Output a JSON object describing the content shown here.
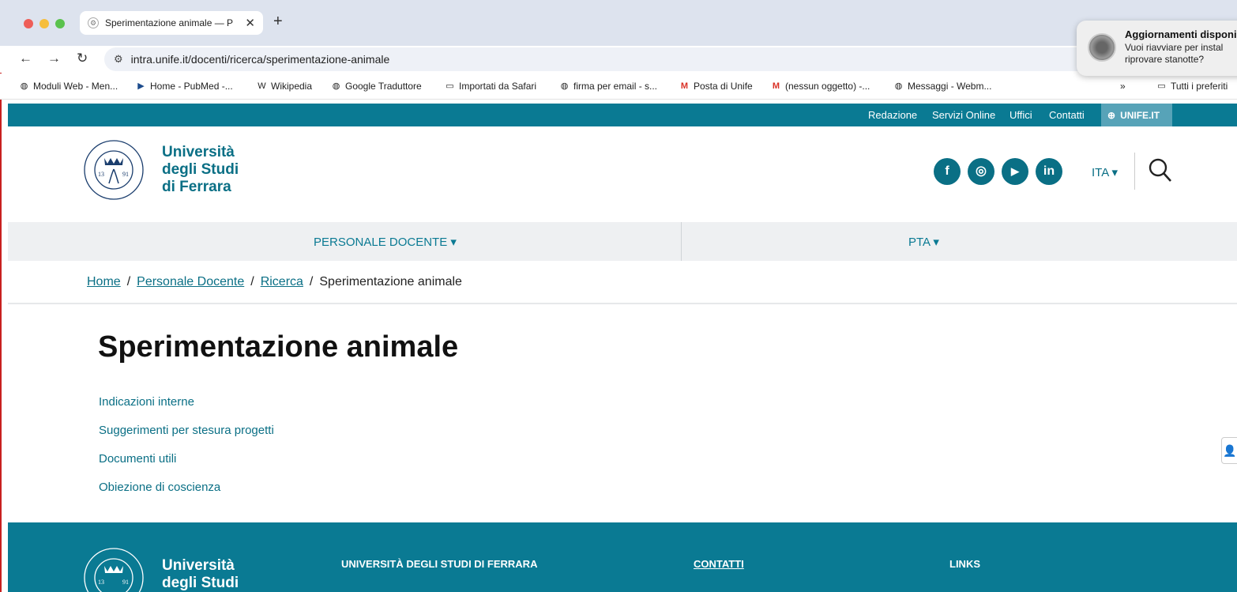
{
  "browser": {
    "tab_title": "Sperimentazione animale — P",
    "tab_close": "✕",
    "new_tab": "+",
    "url": "intra.unife.it/docenti/ricerca/sperimentazione-animale",
    "back_icon": "arrow-left-icon",
    "forward_icon": "arrow-right-icon",
    "reload_icon": "reload-icon",
    "bookmarks": [
      {
        "label": "Moduli Web - Men...",
        "icon": "globe-icon"
      },
      {
        "label": "Home - PubMed -...",
        "icon": "pubmed-icon"
      },
      {
        "label": "Wikipedia",
        "icon": "wikipedia-icon"
      },
      {
        "label": "Google Traduttore",
        "icon": "globe-icon"
      },
      {
        "label": "Importati da Safari",
        "icon": "folder-icon"
      },
      {
        "label": "firma per email - s...",
        "icon": "globe-icon"
      },
      {
        "label": "Posta di Unife",
        "icon": "gmail-icon"
      },
      {
        "label": "(nessun oggetto) -...",
        "icon": "gmail-icon"
      },
      {
        "label": "Messaggi - Webm...",
        "icon": "globe-icon"
      }
    ],
    "bookmarks_more": "»",
    "all_bookmarks": "Tutti i preferiti"
  },
  "notification": {
    "title": "Aggiornamenti disponi",
    "body": "Vuoi riavviare per instal riprovare stanotte?"
  },
  "topbar": {
    "links": [
      "Redazione",
      "Servizi Online",
      "Uffici",
      "Contatti"
    ],
    "unife": "UNIFE.IT"
  },
  "header": {
    "brand_line1": "Università",
    "brand_line2": "degli Studi",
    "brand_line3": "di Ferrara",
    "seal_text_top": "FERRARIAE UNIVERSITAS",
    "seal_text_bottom": "EX LABORE FRUCTUS",
    "seal_year_left": "13",
    "seal_year_right": "91",
    "social": [
      {
        "name": "facebook",
        "glyph": "f"
      },
      {
        "name": "instagram",
        "glyph": "◎"
      },
      {
        "name": "youtube",
        "glyph": "▶"
      },
      {
        "name": "linkedin",
        "glyph": "in"
      }
    ],
    "language": "ITA ▾"
  },
  "menu": {
    "items": [
      "PERSONALE DOCENTE ▾",
      "PTA ▾"
    ]
  },
  "breadcrumb": {
    "home": "Home",
    "level1": "Personale Docente",
    "level2": "Ricerca",
    "current": "Sperimentazione animale",
    "separator": "/"
  },
  "main": {
    "title": "Sperimentazione animale",
    "links": [
      "Indicazioni interne",
      "Suggerimenti per stesura progetti",
      "Documenti utili",
      "Obiezione di coscienza"
    ]
  },
  "footer": {
    "brand_line1": "Università",
    "brand_line2": "degli Studi",
    "col1": "UNIVERSITÀ DEGLI STUDI DI FERRARA",
    "col2": "CONTATTI",
    "col3": "LINKS"
  },
  "colors": {
    "brand": "#0a7a93",
    "brand_dark": "#0a6f85",
    "menu_bg": "#eef0f2"
  }
}
